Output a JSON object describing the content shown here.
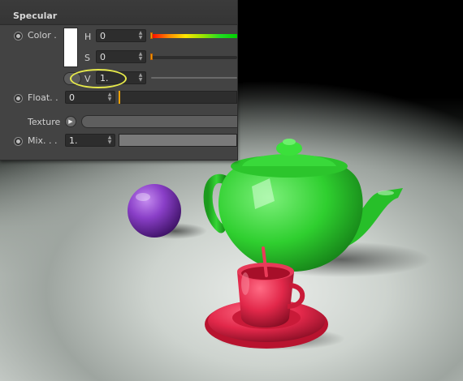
{
  "panel": {
    "title": "Specular",
    "color": {
      "label": "Color",
      "label_suffix": ".",
      "swatch_color": "#ffffff",
      "h": {
        "label": "H",
        "value": "0"
      },
      "s": {
        "label": "S",
        "value": "0"
      },
      "v": {
        "label": "V",
        "value": "1."
      }
    },
    "float": {
      "label": "Float. .",
      "value": "0"
    },
    "texture": {
      "label": "Texture",
      "button_icon": "play-triangle-icon"
    },
    "mix": {
      "label": "Mix. . .",
      "value": "1."
    }
  },
  "colors": {
    "highlight_ellipse": "#e5e84a",
    "slider_handle": "#f0a000",
    "teapot": "#2fcf2f",
    "sphere": "#8a3fc8",
    "cup": "#e2284a"
  }
}
